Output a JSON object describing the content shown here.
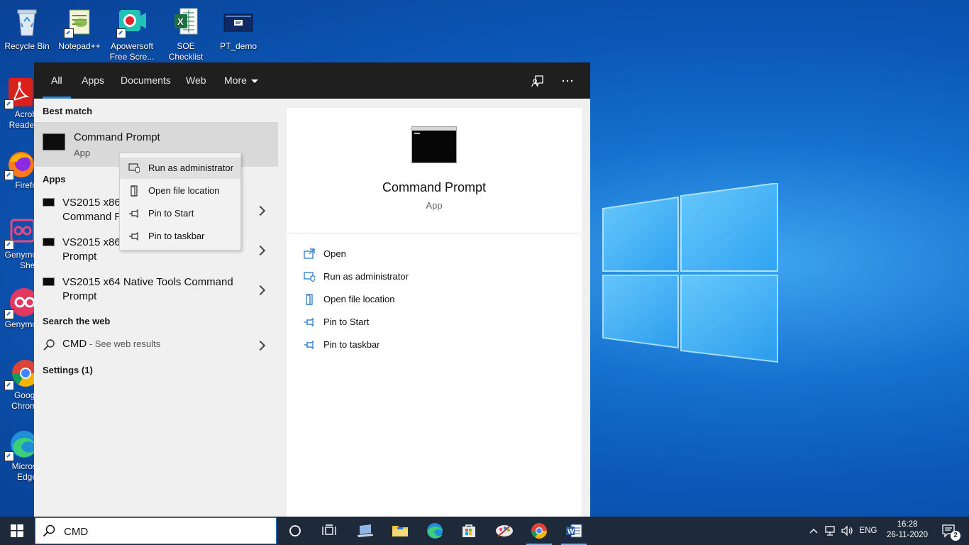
{
  "desktop": {
    "top_icons": [
      {
        "label": "Recycle Bin",
        "icon": "recycle-bin-icon"
      },
      {
        "label": "Notepad++",
        "icon": "notepad-plus-plus-icon"
      },
      {
        "label": "Apowersoft Free Scre...",
        "icon": "apowersoft-icon"
      },
      {
        "label": "SOE Checklist",
        "icon": "excel-file-icon"
      },
      {
        "label": "PT_demo",
        "icon": "pt-demo-icon"
      }
    ],
    "left_icons": [
      {
        "label": "Acrob Reader",
        "icon": "acrobat-reader-icon"
      },
      {
        "label": "Firefo",
        "icon": "firefox-icon"
      },
      {
        "label": "Genymo Shel",
        "icon": "genymotion-shell-icon"
      },
      {
        "label": "Genymo",
        "icon": "genymotion-icon"
      },
      {
        "label": "Googl Chrom",
        "icon": "google-chrome-icon"
      },
      {
        "label": "Micros Edge",
        "icon": "microsoft-edge-icon"
      }
    ]
  },
  "search_panel": {
    "tabs": [
      {
        "label": "All",
        "active": true
      },
      {
        "label": "Apps"
      },
      {
        "label": "Documents"
      },
      {
        "label": "Web"
      },
      {
        "label": "More"
      }
    ],
    "best_match_heading": "Best match",
    "best_match": {
      "title": "Command Prompt",
      "subtitle": "App"
    },
    "apps_heading": "Apps",
    "apps": [
      {
        "line1": "VS2015 x86",
        "line2": "Command P"
      },
      {
        "line1": "VS2015 x86",
        "line2": "Prompt"
      },
      {
        "line1": "VS2015 x64 Native Tools Command",
        "line2": "Prompt"
      }
    ],
    "web_heading": "Search the web",
    "web_result": {
      "query": "CMD",
      "suffix": " - See web results"
    },
    "settings_heading": "Settings (1)",
    "preview": {
      "title": "Command Prompt",
      "subtitle": "App",
      "actions": [
        {
          "label": "Open",
          "icon": "open-icon"
        },
        {
          "label": "Run as administrator",
          "icon": "run-as-admin-icon"
        },
        {
          "label": "Open file location",
          "icon": "file-location-icon"
        },
        {
          "label": "Pin to Start",
          "icon": "pin-icon"
        },
        {
          "label": "Pin to taskbar",
          "icon": "pin-icon"
        }
      ]
    },
    "context_menu": [
      {
        "label": "Run as administrator",
        "icon": "run-as-admin-icon"
      },
      {
        "label": "Open file location",
        "icon": "file-location-icon"
      },
      {
        "label": "Pin to Start",
        "icon": "pin-icon"
      },
      {
        "label": "Pin to taskbar",
        "icon": "pin-icon"
      }
    ]
  },
  "taskbar": {
    "search_value": "CMD",
    "language": "ENG",
    "time": "16:28",
    "date": "26-11-2020",
    "notifications": "2",
    "accent": "#1976d2"
  }
}
